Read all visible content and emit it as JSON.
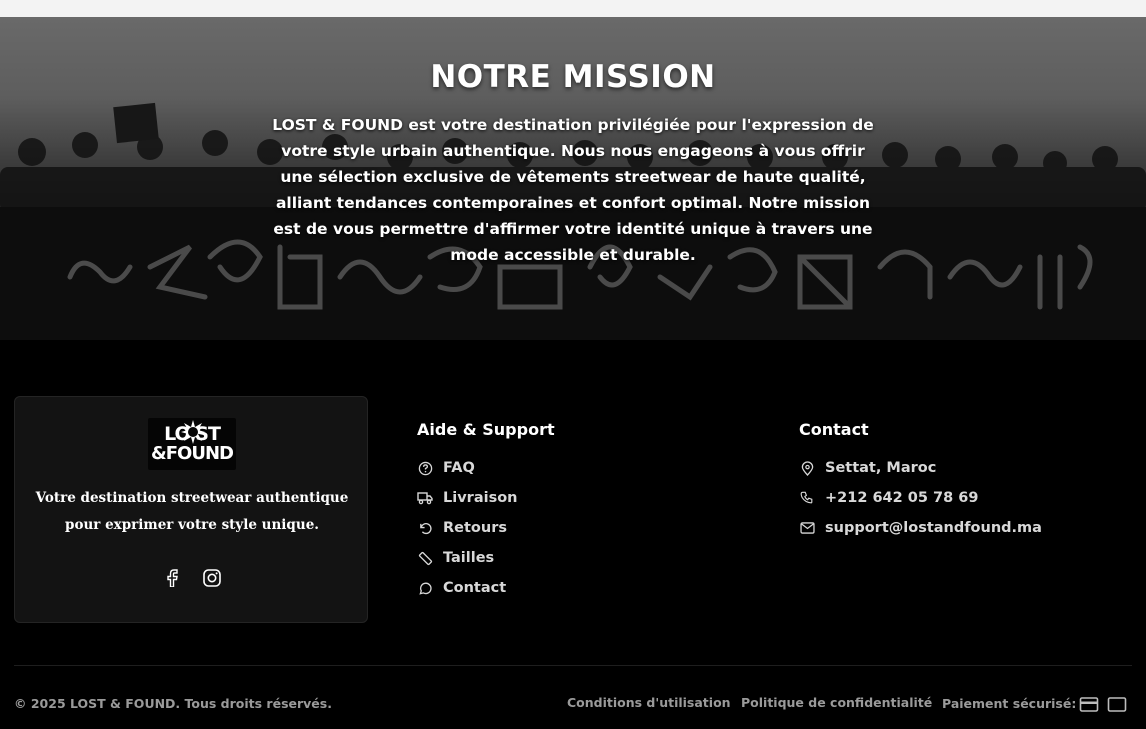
{
  "hero": {
    "title": "NOTRE MISSION",
    "text": "LOST & FOUND est votre destination privilégiée pour l'expression de votre style urbain authentique. Nous nous engageons à vous offrir une sélection exclusive de vêtements streetwear de haute qualité, alliant tendances contemporaines et confort optimal. Notre mission est de vous permettre d'affirmer votre identité unique à travers une mode accessible et durable."
  },
  "brand": {
    "logo_line1": "LO ST",
    "logo_line2": "&FOUND",
    "tagline": "Votre destination streetwear authentique pour exprimer votre style unique.",
    "socials": [
      {
        "icon": "facebook-icon"
      },
      {
        "icon": "instagram-icon"
      }
    ]
  },
  "support": {
    "title": "Aide & Support",
    "links": [
      {
        "label": "FAQ",
        "icon": "help-circle-icon"
      },
      {
        "label": "Livraison",
        "icon": "truck-icon"
      },
      {
        "label": "Retours",
        "icon": "rotate-ccw-icon"
      },
      {
        "label": "Tailles",
        "icon": "ruler-icon"
      },
      {
        "label": "Contact",
        "icon": "message-circle-icon"
      }
    ]
  },
  "contact": {
    "title": "Contact",
    "items": [
      {
        "label": "Settat, Maroc",
        "icon": "map-pin-icon"
      },
      {
        "label": "+212 642 05 78 69",
        "icon": "phone-icon"
      },
      {
        "label": "support@lostandfound.ma",
        "icon": "mail-icon"
      }
    ]
  },
  "footer": {
    "copyright": "© 2025 LOST & FOUND. Tous droits réservés.",
    "terms": "Conditions d'utilisation",
    "privacy": "Politique de confidentialité",
    "payment_label": "Paiement sécurisé:",
    "payment_icons": [
      "credit-card-icon",
      "card-outline-icon"
    ]
  },
  "colors": {
    "background": "#000000",
    "card": "#131313",
    "text": "#ffffff",
    "muted": "#9a9a9a",
    "link": "#d8d8d8"
  }
}
